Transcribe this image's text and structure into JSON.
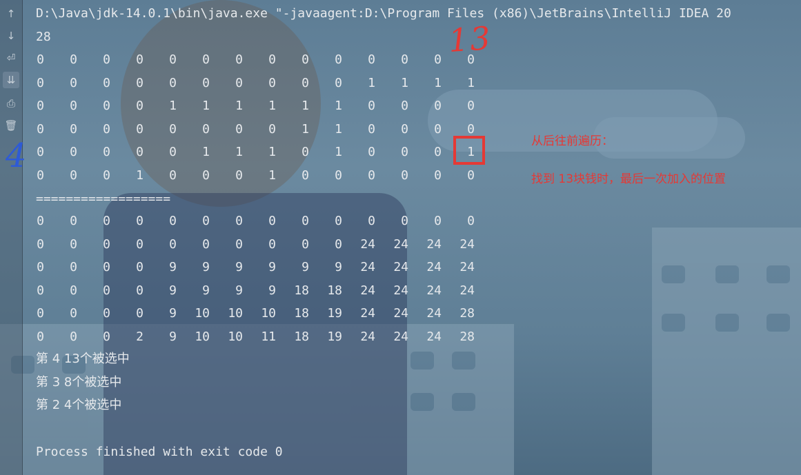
{
  "console": {
    "command_line": "D:\\Java\\jdk-14.0.1\\bin\\java.exe \"-javaagent:D:\\Program Files (x86)\\JetBrains\\IntelliJ IDEA 20",
    "first_output": "28",
    "matrix_a": [
      [
        "0",
        "0",
        "0",
        "0",
        "0",
        "0",
        "0",
        "0",
        "0",
        "0",
        "0",
        "0",
        "0",
        "0"
      ],
      [
        "0",
        "0",
        "0",
        "0",
        "0",
        "0",
        "0",
        "0",
        "0",
        "0",
        "1",
        "1",
        "1",
        "1"
      ],
      [
        "0",
        "0",
        "0",
        "0",
        "1",
        "1",
        "1",
        "1",
        "1",
        "1",
        "0",
        "0",
        "0",
        "0"
      ],
      [
        "0",
        "0",
        "0",
        "0",
        "0",
        "0",
        "0",
        "0",
        "1",
        "1",
        "0",
        "0",
        "0",
        "0"
      ],
      [
        "0",
        "0",
        "0",
        "0",
        "0",
        "1",
        "1",
        "1",
        "0",
        "1",
        "0",
        "0",
        "0",
        "1"
      ],
      [
        "0",
        "0",
        "0",
        "1",
        "0",
        "0",
        "0",
        "1",
        "0",
        "0",
        "0",
        "0",
        "0",
        "0"
      ]
    ],
    "separator": "==================",
    "matrix_b": [
      [
        "0",
        "0",
        "0",
        "0",
        "0",
        "0",
        "0",
        "0",
        "0",
        "0",
        "0",
        "0",
        "0",
        "0"
      ],
      [
        "0",
        "0",
        "0",
        "0",
        "0",
        "0",
        "0",
        "0",
        "0",
        "0",
        "24",
        "24",
        "24",
        "24"
      ],
      [
        "0",
        "0",
        "0",
        "0",
        "9",
        "9",
        "9",
        "9",
        "9",
        "9",
        "24",
        "24",
        "24",
        "24"
      ],
      [
        "0",
        "0",
        "0",
        "0",
        "9",
        "9",
        "9",
        "9",
        "18",
        "18",
        "24",
        "24",
        "24",
        "24"
      ],
      [
        "0",
        "0",
        "0",
        "0",
        "9",
        "10",
        "10",
        "10",
        "18",
        "19",
        "24",
        "24",
        "24",
        "28"
      ],
      [
        "0",
        "0",
        "0",
        "2",
        "9",
        "10",
        "10",
        "11",
        "18",
        "19",
        "24",
        "24",
        "24",
        "28"
      ]
    ],
    "selections": [
      "第 4 13个被选中",
      "第 3 8个被选中",
      "第 2 4个被选中"
    ],
    "exit_message": "Process finished with exit code 0"
  },
  "toolbar": {
    "icons": [
      "arrow-up-icon",
      "arrow-down-icon",
      "soft-wrap-icon",
      "scroll-to-end-icon",
      "print-icon",
      "trash-icon"
    ]
  },
  "annotations": {
    "handwritten_top": "13",
    "handwritten_left": "4",
    "note_line1": "从后往前遍历：",
    "note_line2": "找到 13块钱时，最后一次加入的位置",
    "highlight_color": "#e53935"
  }
}
